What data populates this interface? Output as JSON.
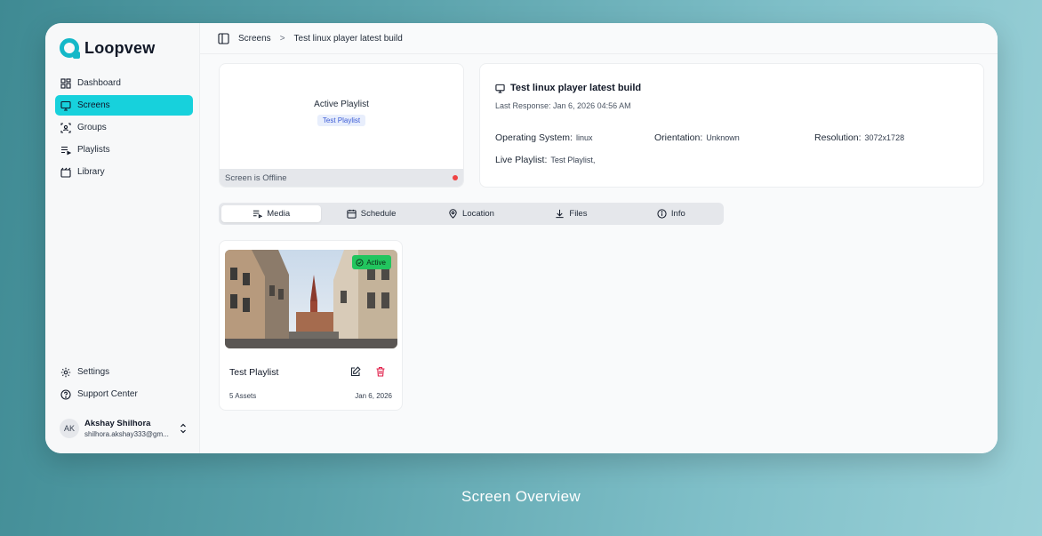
{
  "app": {
    "name": "Loopvew"
  },
  "sidebar": {
    "items": [
      {
        "label": "Dashboard",
        "icon": "dashboard-icon"
      },
      {
        "label": "Screens",
        "icon": "monitor-icon",
        "active": true
      },
      {
        "label": "Groups",
        "icon": "groups-icon"
      },
      {
        "label": "Playlists",
        "icon": "playlist-icon"
      },
      {
        "label": "Library",
        "icon": "library-icon"
      }
    ],
    "bottom": [
      {
        "label": "Settings",
        "icon": "gear-icon"
      },
      {
        "label": "Support Center",
        "icon": "help-icon"
      }
    ],
    "user": {
      "initials": "AK",
      "name": "Akshay Shilhora",
      "email": "shilhora.akshay333@gm..."
    }
  },
  "breadcrumb": {
    "root": "Screens",
    "separator": ">",
    "current": "Test linux player latest build"
  },
  "preview": {
    "title": "Active Playlist",
    "chip": "Test Playlist",
    "status": "Screen is Offline",
    "status_color": "#ef4444"
  },
  "screen_info": {
    "title": "Test linux player latest build",
    "last_response": "Last Response: Jan 6, 2026 04:56 AM",
    "os_label": "Operating System:",
    "os_value": "linux",
    "orientation_label": "Orientation:",
    "orientation_value": "Unknown",
    "resolution_label": "Resolution:",
    "resolution_value": "3072x1728",
    "live_label": "Live Playlist:",
    "live_value": "Test Playlist,"
  },
  "tabs": [
    {
      "label": "Media",
      "icon": "media-icon",
      "active": true
    },
    {
      "label": "Schedule",
      "icon": "calendar-icon"
    },
    {
      "label": "Location",
      "icon": "location-pin-icon"
    },
    {
      "label": "Files",
      "icon": "download-icon"
    },
    {
      "label": "Info",
      "icon": "info-icon"
    }
  ],
  "playlist_card": {
    "badge": "Active",
    "badge_color": "#22c55e",
    "title": "Test Playlist",
    "assets": "5 Assets",
    "date": "Jan 6, 2026"
  },
  "caption": "Screen Overview",
  "colors": {
    "accent": "#17d1dc",
    "brand": "#14b8c8",
    "danger": "#e11d48"
  }
}
